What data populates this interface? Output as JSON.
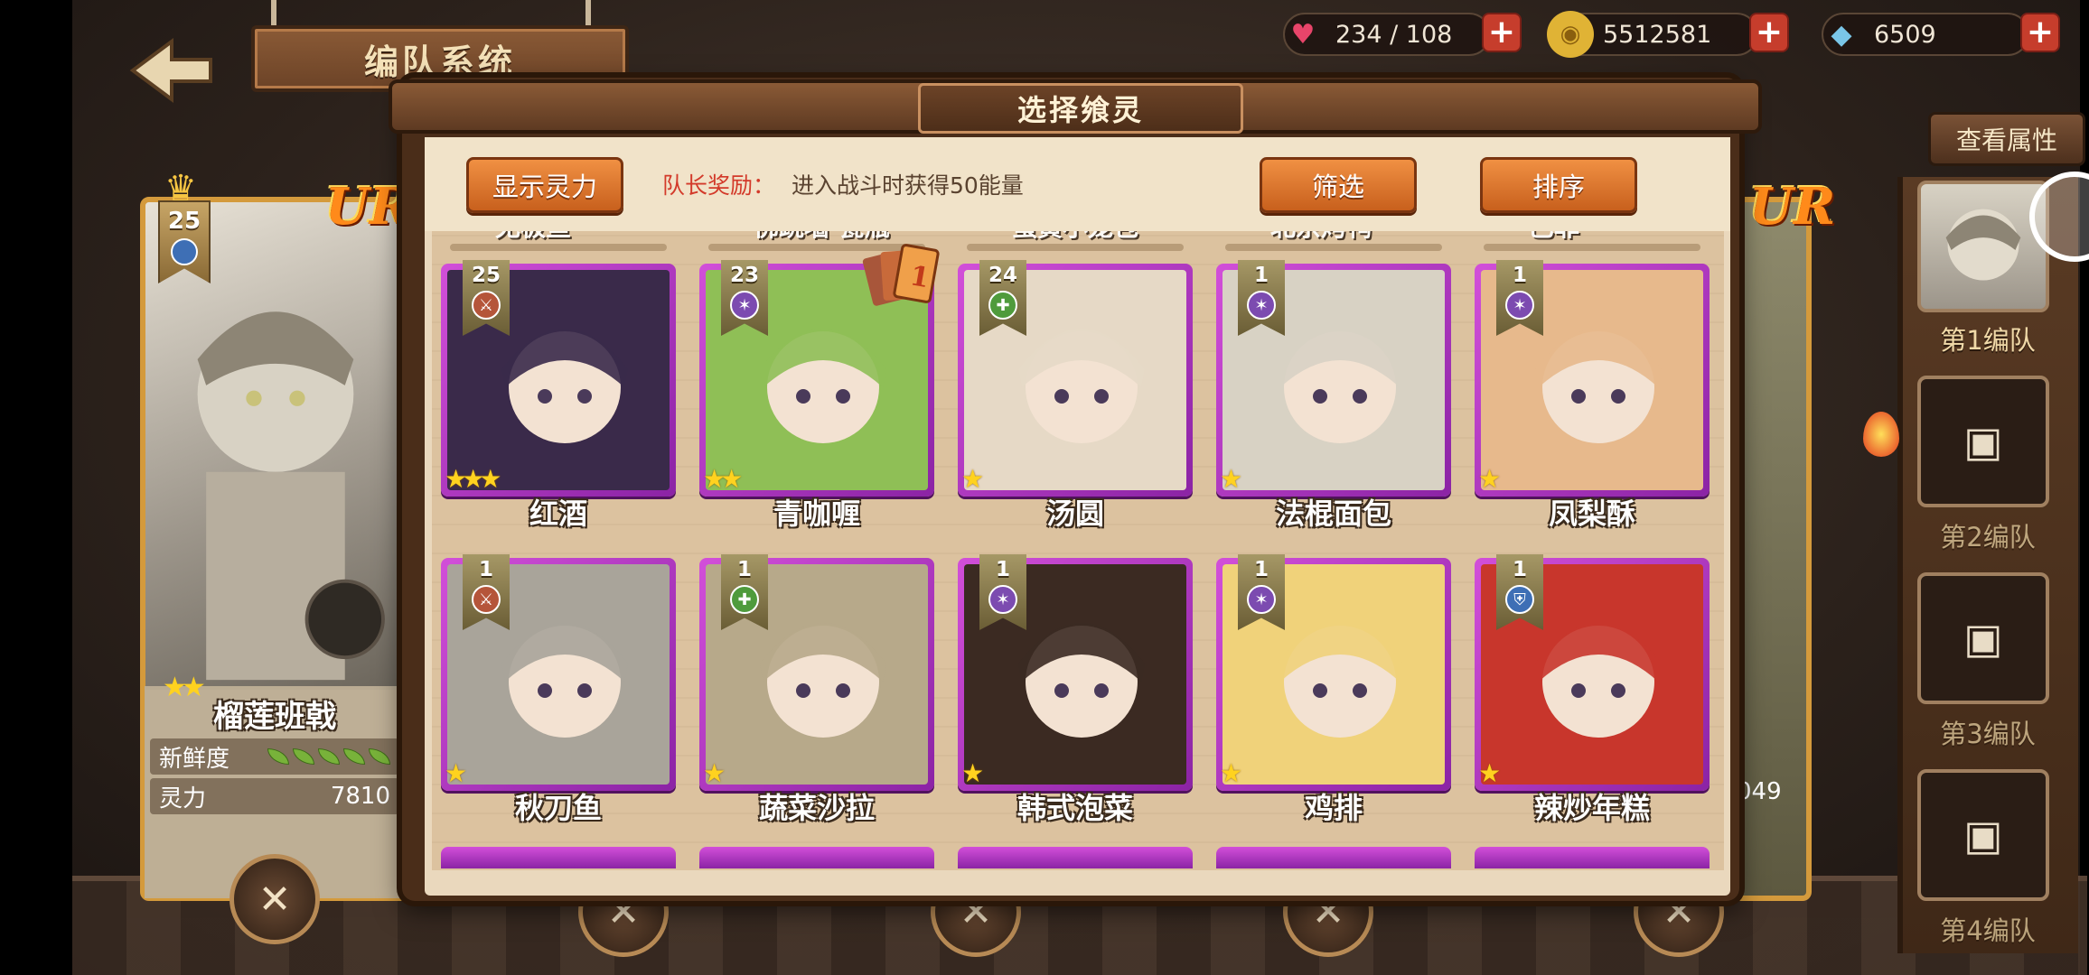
{
  "header": {
    "title": "编队系统",
    "resources": [
      {
        "icon": "heart-icon",
        "value": "234 / 108",
        "color": "#e8456a"
      },
      {
        "icon": "coin-icon",
        "value": "5512581",
        "color": "#e0b335"
      },
      {
        "icon": "crystal-icon",
        "value": "6509",
        "color": "#7ac6e8"
      }
    ],
    "plus": "+"
  },
  "left_card": {
    "level": "25",
    "rarity": "UR",
    "name": "榴莲班戟",
    "stars": 2,
    "freshness_label": "新鲜度",
    "power_label": "灵力",
    "power_value": "7810"
  },
  "right_partial": {
    "rarity": "UR",
    "power_value": "049"
  },
  "right_panel": {
    "view_attr": "查看属性",
    "teams": [
      "第1编队",
      "第2编队",
      "第3编队",
      "第4编队"
    ]
  },
  "modal": {
    "title": "选择飨灵",
    "show_power": "显示灵力",
    "reward_label": "队长奖励：",
    "reward_text": "进入战斗时获得50能量",
    "filter": "筛选",
    "sort": "排序",
    "row_prev_names": [
      "无极鱼",
      "佛跳墙·瓷瓶",
      "蛋黄小笼包",
      "北京烤鸭",
      "巴菲"
    ],
    "cards": [
      {
        "name": "红酒",
        "level": "25",
        "stars": 3,
        "class": "sword",
        "art": "#3a2a4a"
      },
      {
        "name": "青咖喱",
        "level": "23",
        "stars": 2,
        "class": "magic",
        "art": "#8fbf56"
      },
      {
        "name": "汤圆",
        "level": "24",
        "stars": 1,
        "class": "heal",
        "art": "#e6d9c6"
      },
      {
        "name": "法棍面包",
        "level": "1",
        "stars": 1,
        "class": "magic",
        "art": "#d8d2c4"
      },
      {
        "name": "凤梨酥",
        "level": "1",
        "stars": 1,
        "class": "magic",
        "art": "#e7b98c"
      },
      {
        "name": "秋刀鱼",
        "level": "1",
        "stars": 1,
        "class": "sword",
        "art": "#a9a49a"
      },
      {
        "name": "蔬菜沙拉",
        "level": "1",
        "stars": 1,
        "class": "heal",
        "art": "#b7a98a"
      },
      {
        "name": "韩式泡菜",
        "level": "1",
        "stars": 1,
        "class": "magic",
        "art": "#3b2a22"
      },
      {
        "name": "鸡排",
        "level": "1",
        "stars": 1,
        "class": "magic",
        "art": "#f0d27a"
      },
      {
        "name": "辣炒年糕",
        "level": "1",
        "stars": 1,
        "class": "shield",
        "art": "#c8362c"
      }
    ],
    "tarot_value": "1"
  },
  "colors": {
    "sword": "#b5553a",
    "magic": "#7c4bb0",
    "heal": "#4f9b3c",
    "shield": "#3e6fb5"
  }
}
